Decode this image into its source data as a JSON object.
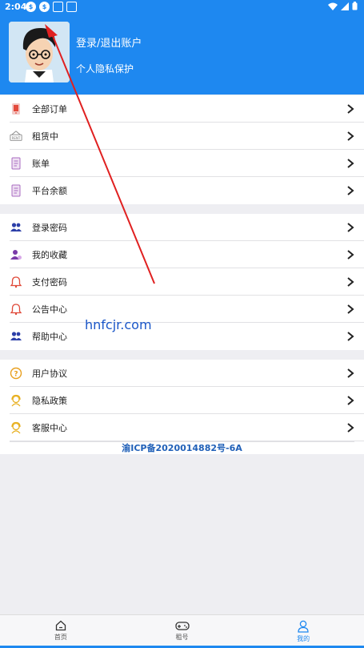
{
  "status": {
    "time": "2:04"
  },
  "header": {
    "login_text": "登录/退出账户",
    "privacy_text": "个人隐私保护"
  },
  "group1": [
    {
      "label": "全部订单",
      "icon": "order-phone-icon"
    },
    {
      "label": "租赁中",
      "icon": "rent-sign-icon"
    },
    {
      "label": "账单",
      "icon": "bill-doc-icon"
    },
    {
      "label": "平台余额",
      "icon": "balance-doc-icon"
    }
  ],
  "group2": [
    {
      "label": "登录密码",
      "icon": "users-icon"
    },
    {
      "label": "我的收藏",
      "icon": "user-favorite-icon"
    },
    {
      "label": "支付密码",
      "icon": "bell-icon"
    },
    {
      "label": "公告中心",
      "icon": "bell-icon"
    },
    {
      "label": "帮助中心",
      "icon": "users-icon"
    }
  ],
  "group3": [
    {
      "label": "用户协议",
      "icon": "question-icon"
    },
    {
      "label": "隐私政策",
      "icon": "service-icon"
    },
    {
      "label": "客服中心",
      "icon": "service-icon"
    }
  ],
  "icp": "渝ICP备2020014882号-6A",
  "watermark": "hnfcjr.com",
  "tabs": [
    {
      "label": "首页",
      "icon": "home-icon",
      "active": false
    },
    {
      "label": "租号",
      "icon": "gamepad-icon",
      "active": false
    },
    {
      "label": "我的",
      "icon": "profile-icon",
      "active": true
    }
  ],
  "colors": {
    "primary": "#1e88f0",
    "annotation_arrow": "#e02020"
  }
}
